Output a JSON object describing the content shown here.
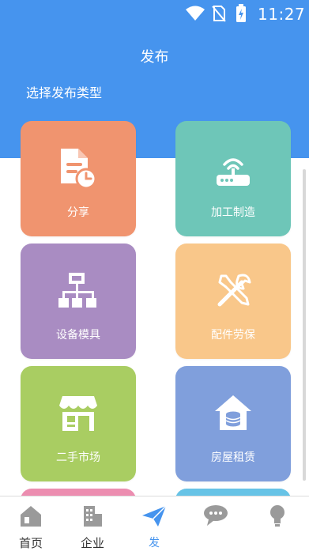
{
  "status_bar": {
    "time": "11:27"
  },
  "header": {
    "title": "发布",
    "section_title": "选择发布类型"
  },
  "categories": [
    {
      "label": "分享",
      "icon": "document-clock-icon",
      "color": "#f0946f"
    },
    {
      "label": "加工制造",
      "icon": "router-icon",
      "color": "#6ec6b8"
    },
    {
      "label": "设备模具",
      "icon": "hierarchy-icon",
      "color": "#a98cc2"
    },
    {
      "label": "配件劳保",
      "icon": "tools-icon",
      "color": "#f9c78a"
    },
    {
      "label": "二手市场",
      "icon": "storefront-icon",
      "color": "#a9cd62"
    },
    {
      "label": "房屋租赁",
      "icon": "house-coins-icon",
      "color": "#809fdc"
    }
  ],
  "tabbar": {
    "items": [
      {
        "label": "首页",
        "icon": "home-icon"
      },
      {
        "label": "企业",
        "icon": "building-icon"
      },
      {
        "label": "发",
        "icon": "paper-plane-icon",
        "active": true
      },
      {
        "label": "",
        "icon": "chat-icon"
      },
      {
        "label": "",
        "icon": "bulb-icon"
      }
    ],
    "active_color": "#4694ee"
  }
}
